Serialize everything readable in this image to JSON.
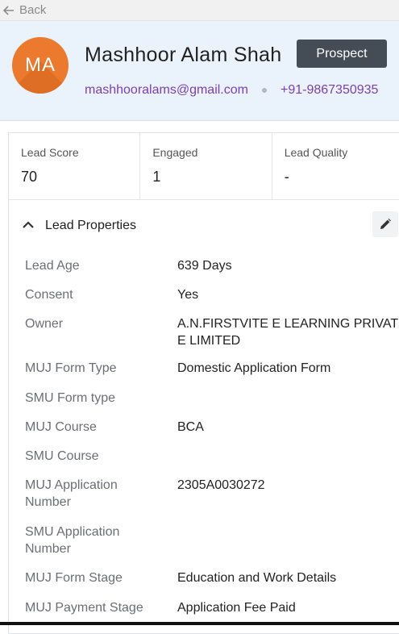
{
  "nav": {
    "back_label": "Back"
  },
  "lead": {
    "initials": "MA",
    "name": "Mashhoor Alam Shah",
    "status": "Prospect",
    "email": "mashhooralams@gmail.com",
    "phone": "+91-9867350935",
    "avatar_color": "#ec7a2e"
  },
  "stats": [
    {
      "label": "Lead Score",
      "value": "70"
    },
    {
      "label": "Engaged",
      "value": "1"
    },
    {
      "label": "Lead Quality",
      "value": "-"
    }
  ],
  "properties_section": {
    "title": "Lead Properties",
    "items": [
      {
        "label": "Lead Age",
        "value": "639 Days"
      },
      {
        "label": "Consent",
        "value": "Yes"
      },
      {
        "label": "Owner",
        "value": "A.N.FIRSTVITE E LEARNING PRIVATE LIMITED"
      },
      {
        "label": "MUJ Form Type",
        "value": "Domestic Application Form"
      },
      {
        "label": "SMU Form type",
        "value": ""
      },
      {
        "label": "MUJ Course",
        "value": "BCA"
      },
      {
        "label": "SMU Course",
        "value": ""
      },
      {
        "label": "MUJ Application Number",
        "value": "2305A0030272"
      },
      {
        "label": "SMU Application Number",
        "value": ""
      },
      {
        "label": "MUJ Form Stage",
        "value": "Education and Work Details"
      },
      {
        "label": "MUJ Payment Stage",
        "value": "Application Fee Paid"
      }
    ]
  },
  "colors": {
    "accent_link": "#7b3fb3",
    "status_button": "#444c56",
    "header_bg": "#eaf3fb"
  }
}
